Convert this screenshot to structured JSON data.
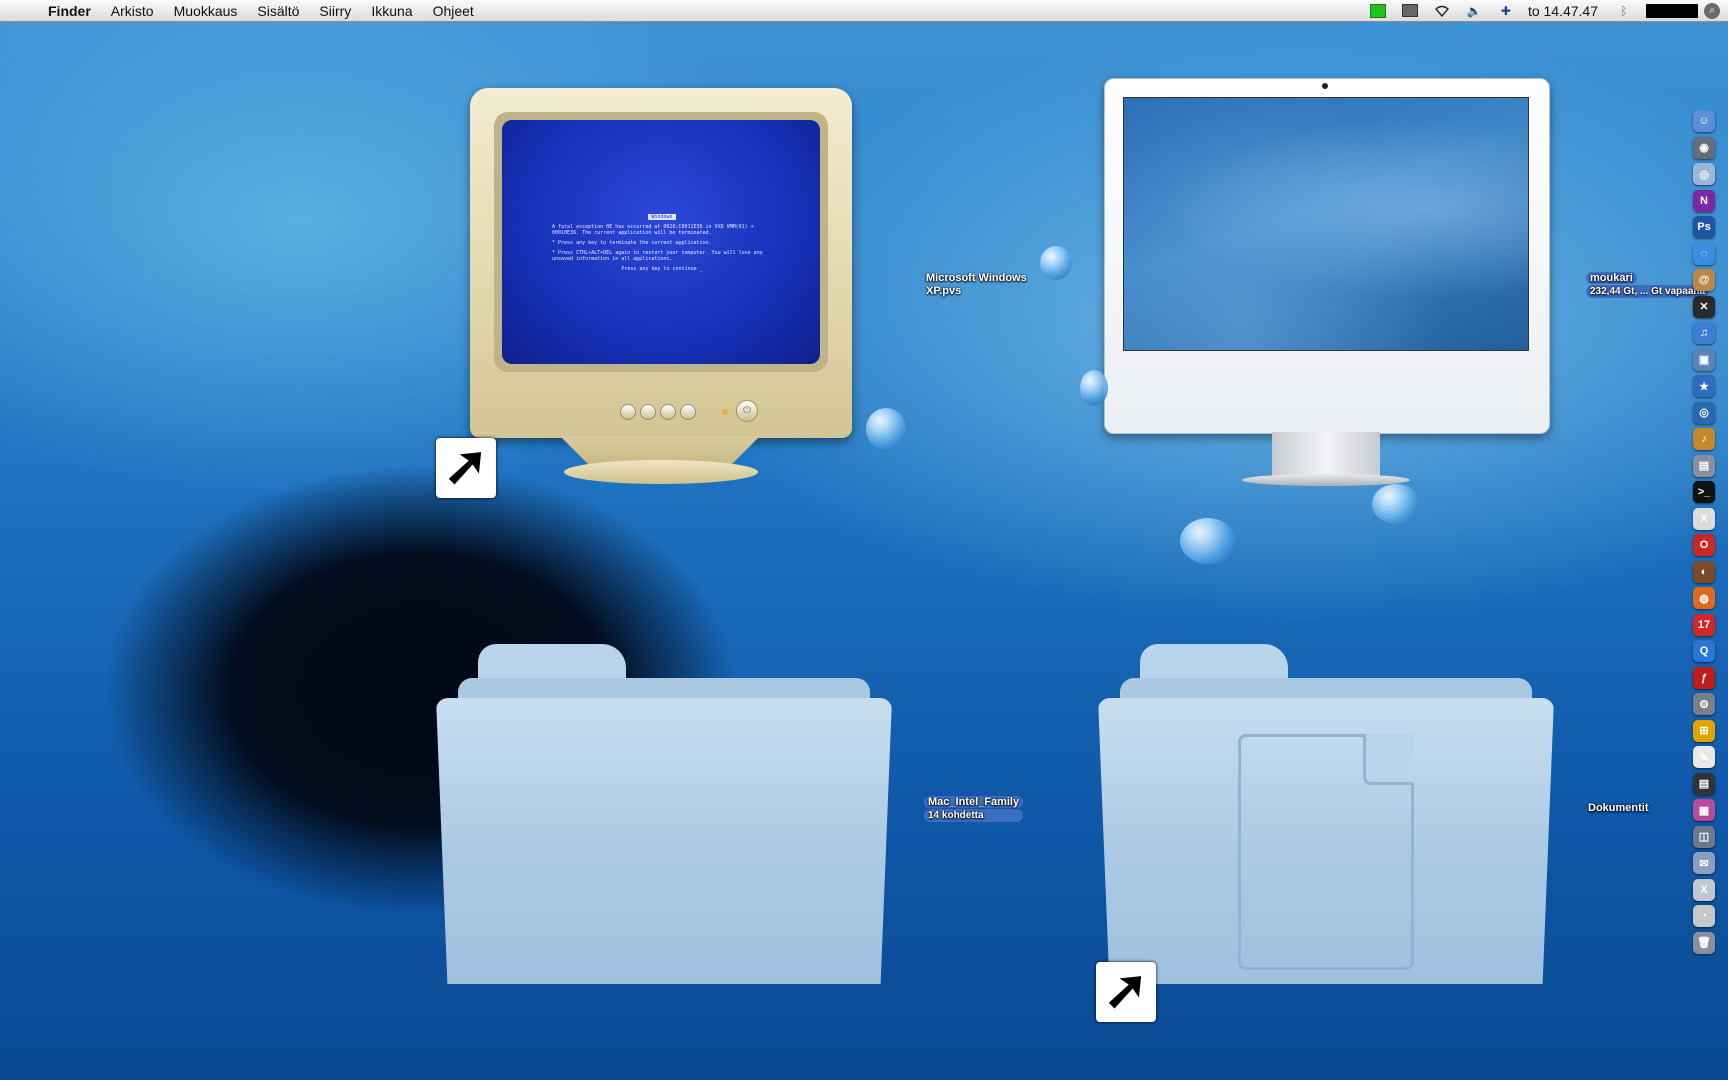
{
  "menubar": {
    "apple_glyph": "",
    "app_name": "Finder",
    "items": [
      "Arkisto",
      "Muokkaus",
      "Sisältö",
      "Siirry",
      "Ikkuna",
      "Ohjeet"
    ],
    "clock": "to 14.47.47",
    "flag_glyph": "✚",
    "bluetooth_glyph": "ᛒ",
    "volume_glyph": "🔈",
    "spotlight_glyph": "⌕"
  },
  "desktop": {
    "items": [
      {
        "name": "Microsoft Windows XP.pvs",
        "line1": "Microsoft Windows",
        "line2": "XP.pvs"
      },
      {
        "name": "moukari",
        "subtitle": "232,44 Gt, ... Gt vapaana"
      },
      {
        "name": "Mac_Intel_Family",
        "subtitle": "14 kohdetta"
      },
      {
        "name": "Dokumentit"
      }
    ],
    "alias_glyph": "➚"
  },
  "bsod": {
    "title": "Windows",
    "line1": "A fatal exception 0E has occurred at 0028:C0011E36 in VXD VMM(01) + 00010E36. The current application will be terminated.",
    "line2": "* Press any key to terminate the current application.",
    "line3": "* Press CTRL+ALT+DEL again to restart your computer. You will lose any unsaved information in all applications.",
    "line4": "Press any key to continue _"
  },
  "dock": {
    "items": [
      {
        "name": "finder",
        "color": "#5a8fd6",
        "glyph": "☺"
      },
      {
        "name": "dashboard",
        "color": "#666c7a",
        "glyph": "◉"
      },
      {
        "name": "safari",
        "color": "#9bb6d6",
        "glyph": "◎"
      },
      {
        "name": "nvu",
        "color": "#7a2aa0",
        "glyph": "N"
      },
      {
        "name": "photoshop",
        "color": "#1c55a4",
        "glyph": "Ps"
      },
      {
        "name": "ichat",
        "color": "#3a8de0",
        "glyph": "◌"
      },
      {
        "name": "address-book",
        "color": "#b8874a",
        "glyph": "@"
      },
      {
        "name": "activity-monitor",
        "color": "#2a2a2a",
        "glyph": "✕"
      },
      {
        "name": "itunes",
        "color": "#3b7fd4",
        "glyph": "♫"
      },
      {
        "name": "iphoto",
        "color": "#5a84b8",
        "glyph": "▣"
      },
      {
        "name": "imovie",
        "color": "#2d6cc0",
        "glyph": "★"
      },
      {
        "name": "idvd",
        "color": "#2a68b2",
        "glyph": "◎"
      },
      {
        "name": "garageband",
        "color": "#c48a2a",
        "glyph": "♪"
      },
      {
        "name": "preview",
        "color": "#8a8fa0",
        "glyph": "▤"
      },
      {
        "name": "terminal",
        "color": "#111111",
        "glyph": ">_"
      },
      {
        "name": "x11",
        "color": "#dcdcdc",
        "glyph": "X"
      },
      {
        "name": "opera",
        "color": "#c82828",
        "glyph": "O"
      },
      {
        "name": "camino",
        "color": "#7a4a2a",
        "glyph": "◐"
      },
      {
        "name": "firefox",
        "color": "#e06a1c",
        "glyph": "◍"
      },
      {
        "name": "ical",
        "color": "#d02828",
        "glyph": "17"
      },
      {
        "name": "quicktime",
        "color": "#2a76d2",
        "glyph": "Q"
      },
      {
        "name": "flash",
        "color": "#c01c1c",
        "glyph": "ƒ"
      },
      {
        "name": "system-preferences",
        "color": "#7a7f88",
        "glyph": "⚙"
      },
      {
        "name": "ms-office",
        "color": "#e0a400",
        "glyph": "⊞"
      },
      {
        "name": "textedit",
        "color": "#e8e8e8",
        "glyph": "✎"
      },
      {
        "name": "console",
        "color": "#333333",
        "glyph": "▤"
      },
      {
        "name": "color-sync",
        "color": "#b84a9a",
        "glyph": "▦"
      },
      {
        "name": "image-capture",
        "color": "#6a7a8a",
        "glyph": "◫"
      },
      {
        "name": "mail-stamp",
        "color": "#8aa0c0",
        "glyph": "✉"
      },
      {
        "name": "x-app",
        "color": "#c0c8d2",
        "glyph": "X"
      },
      {
        "name": "disk-utility",
        "color": "#c8c8c8",
        "glyph": "◔"
      },
      {
        "name": "trash",
        "color": "#8a9098",
        "glyph": "🗑"
      }
    ]
  }
}
